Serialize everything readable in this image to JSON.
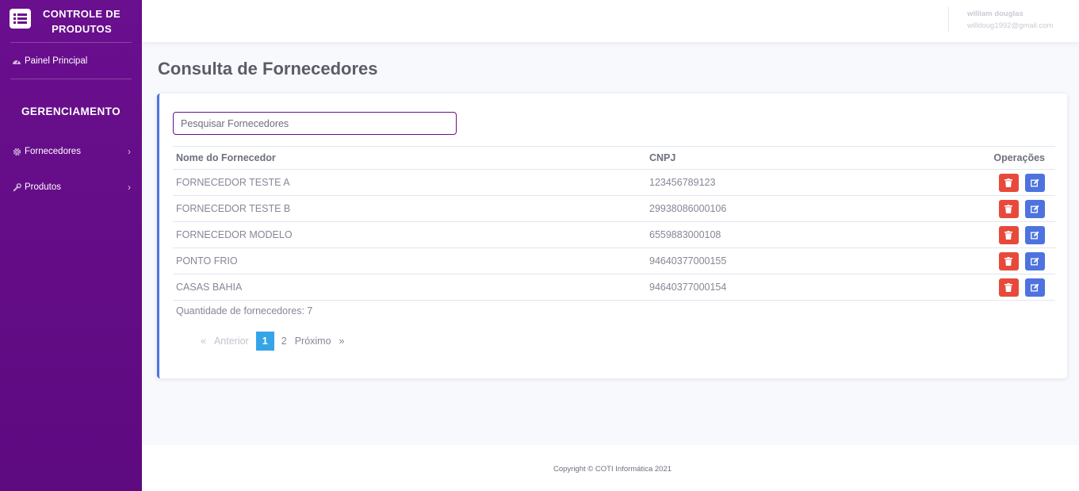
{
  "brand": {
    "title_line1": "CONTROLE DE",
    "title_line2": "PRODUTOS",
    "icon": "list-icon"
  },
  "sidebar": {
    "dashboard": {
      "label": "Painel Principal",
      "icon": "gauge-icon"
    },
    "heading": "GERENCIAMENTO",
    "items": [
      {
        "label": "Fornecedores",
        "icon": "gear-icon"
      },
      {
        "label": "Produtos",
        "icon": "wrench-icon"
      }
    ]
  },
  "topbar": {
    "user_name": "william douglas",
    "user_email": "willdoug1992@gmail.com"
  },
  "page": {
    "title": "Consulta de Fornecedores"
  },
  "search": {
    "placeholder": "Pesquisar Fornecedores",
    "value": ""
  },
  "table": {
    "headers": {
      "name": "Nome do Fornecedor",
      "cnpj": "CNPJ",
      "ops": "Operações"
    },
    "rows": [
      {
        "name": "FORNECEDOR TESTE A",
        "cnpj": "123456789123"
      },
      {
        "name": "FORNECEDOR TESTE B",
        "cnpj": "29938086000106"
      },
      {
        "name": "FORNECEDOR MODELO",
        "cnpj": "6559883000108"
      },
      {
        "name": "PONTO FRIO",
        "cnpj": "94640377000155"
      },
      {
        "name": "CASAS BAHIA",
        "cnpj": "94640377000154"
      }
    ]
  },
  "count_text": "Quantidade de fornecedores: 7",
  "pagination": {
    "prev_arrow": "«",
    "prev": "Anterior",
    "current": "1",
    "page2": "2",
    "next": "Próximo",
    "next_arrow": "»"
  },
  "footer": {
    "copyright": "Copyright © COTI Informática 2021"
  },
  "colors": {
    "sidebar": "#6a0f8e",
    "delete": "#e74a3b",
    "edit": "#4e73df",
    "active_page": "#36a4e8",
    "card_accent": "#4e73df"
  }
}
